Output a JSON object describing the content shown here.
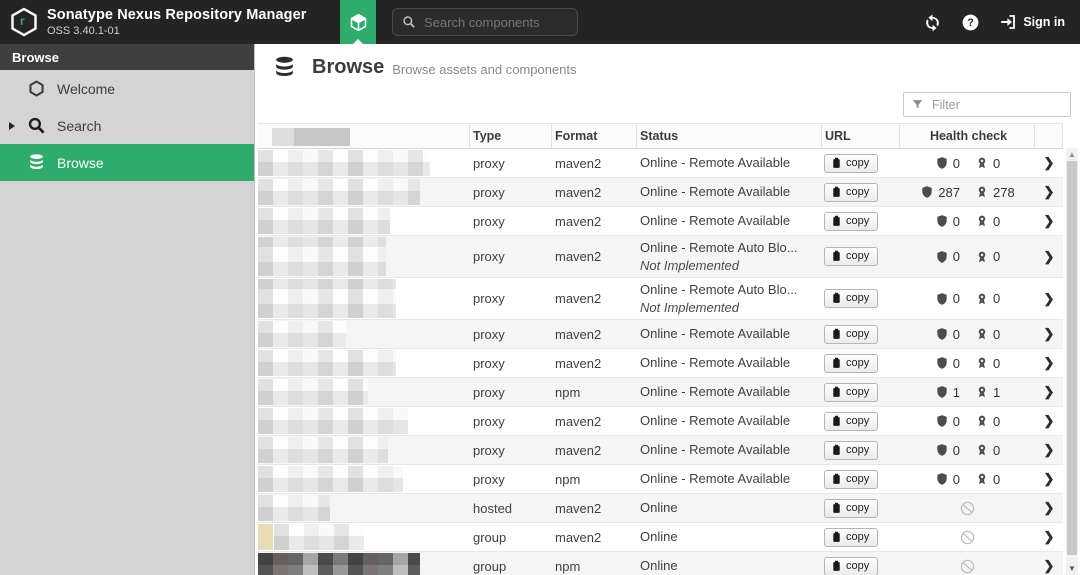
{
  "colors": {
    "accent_green": "#2fac6b",
    "header_bg": "#242424",
    "sidebar_bg": "#d4d4d4",
    "row_alt_bg": "#f5f5f5"
  },
  "header": {
    "brand_title": "Sonatype Nexus Repository Manager",
    "brand_version": "OSS 3.40.1-01",
    "search_placeholder": "Search components",
    "sign_in_label": "Sign in"
  },
  "sidebar": {
    "section_title": "Browse",
    "items": [
      {
        "label": "Welcome",
        "icon": "hexagon-icon",
        "selected": false
      },
      {
        "label": "Search",
        "icon": "search-icon",
        "selected": false,
        "expandable": true
      },
      {
        "label": "Browse",
        "icon": "database-icon",
        "selected": true
      }
    ]
  },
  "page": {
    "title": "Browse",
    "subtitle": "Browse assets and components",
    "filter_placeholder": "Filter"
  },
  "table": {
    "columns": [
      "Type",
      "Format",
      "Status",
      "URL",
      "Health check"
    ],
    "copy_label": "copy",
    "rows": [
      {
        "type": "proxy",
        "format": "maven2",
        "status": "Online - Remote Available",
        "status_note": "",
        "health": "counts",
        "security_issues": 0,
        "license_issues": 0,
        "blur_width": 172,
        "blur_style": "normal"
      },
      {
        "type": "proxy",
        "format": "maven2",
        "status": "Online - Remote Available",
        "status_note": "",
        "health": "counts",
        "security_issues": 287,
        "license_issues": 278,
        "blur_width": 162,
        "blur_style": "normal"
      },
      {
        "type": "proxy",
        "format": "maven2",
        "status": "Online - Remote Available",
        "status_note": "",
        "health": "counts",
        "security_issues": 0,
        "license_issues": 0,
        "blur_width": 132,
        "blur_style": "normal"
      },
      {
        "type": "proxy",
        "format": "maven2",
        "status": "Online - Remote Auto Blo...",
        "status_note": "Not Implemented",
        "health": "counts",
        "security_issues": 0,
        "license_issues": 0,
        "blur_width": 128,
        "blur_style": "normal"
      },
      {
        "type": "proxy",
        "format": "maven2",
        "status": "Online - Remote Auto Blo...",
        "status_note": "Not Implemented",
        "health": "counts",
        "security_issues": 0,
        "license_issues": 0,
        "blur_width": 138,
        "blur_style": "normal"
      },
      {
        "type": "proxy",
        "format": "maven2",
        "status": "Online - Remote Available",
        "status_note": "",
        "health": "counts",
        "security_issues": 0,
        "license_issues": 0,
        "blur_width": 88,
        "blur_style": "normal"
      },
      {
        "type": "proxy",
        "format": "maven2",
        "status": "Online - Remote Available",
        "status_note": "",
        "health": "counts",
        "security_issues": 0,
        "license_issues": 0,
        "blur_width": 138,
        "blur_style": "normal"
      },
      {
        "type": "proxy",
        "format": "npm",
        "status": "Online - Remote Available",
        "status_note": "",
        "health": "counts",
        "security_issues": 1,
        "license_issues": 1,
        "blur_width": 110,
        "blur_style": "normal"
      },
      {
        "type": "proxy",
        "format": "maven2",
        "status": "Online - Remote Available",
        "status_note": "",
        "health": "counts",
        "security_issues": 0,
        "license_issues": 0,
        "blur_width": 150,
        "blur_style": "normal"
      },
      {
        "type": "proxy",
        "format": "maven2",
        "status": "Online - Remote Available",
        "status_note": "",
        "health": "counts",
        "security_issues": 0,
        "license_issues": 0,
        "blur_width": 130,
        "blur_style": "normal"
      },
      {
        "type": "proxy",
        "format": "npm",
        "status": "Online - Remote Available",
        "status_note": "",
        "health": "counts",
        "security_issues": 0,
        "license_issues": 0,
        "blur_width": 145,
        "blur_style": "normal"
      },
      {
        "type": "hosted",
        "format": "maven2",
        "status": "Online",
        "status_note": "",
        "health": "unavailable",
        "blur_width": 72,
        "blur_style": "normal"
      },
      {
        "type": "group",
        "format": "maven2",
        "status": "Online",
        "status_note": "",
        "health": "unavailable",
        "blur_width": 90,
        "blur_style": "tan"
      },
      {
        "type": "group",
        "format": "npm",
        "status": "Online",
        "status_note": "",
        "health": "unavailable",
        "blur_width": 162,
        "blur_style": "dark"
      }
    ]
  }
}
